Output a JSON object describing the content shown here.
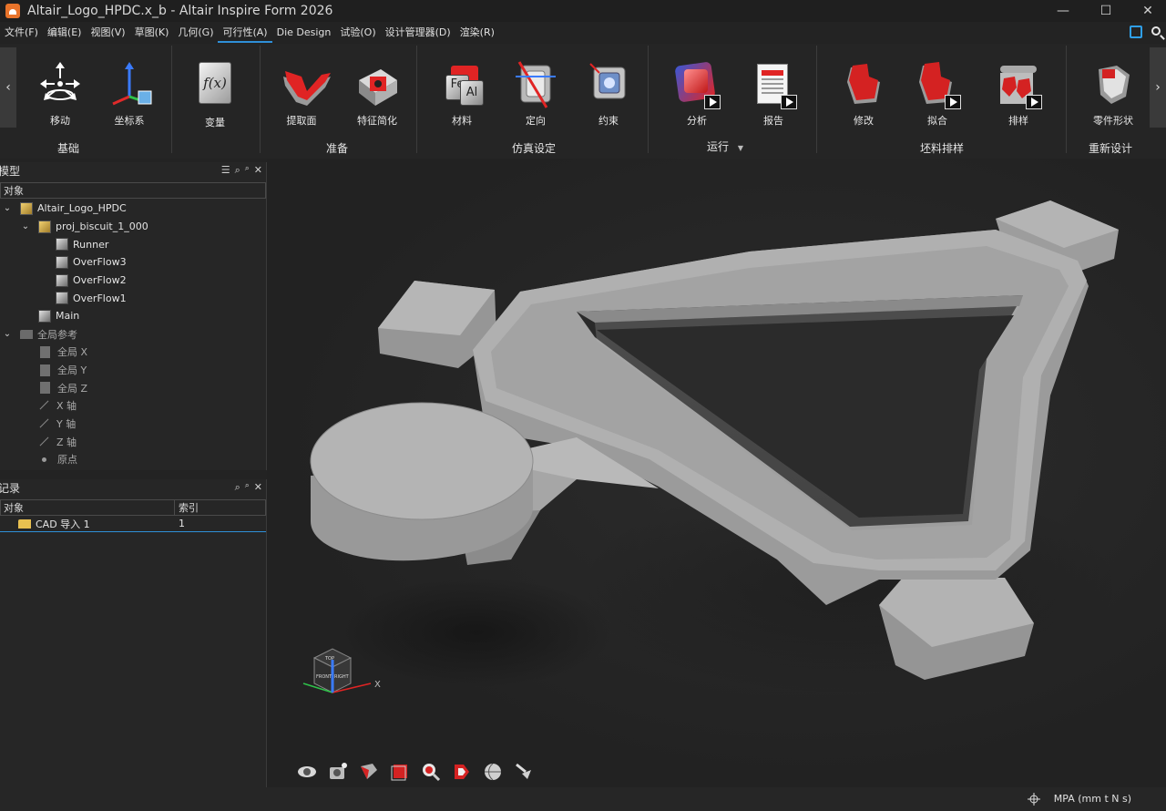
{
  "window": {
    "title": "Altair_Logo_HPDC.x_b - Altair Inspire Form 2026",
    "minimize": "—",
    "maximize": "☐",
    "close": "✕"
  },
  "menu": {
    "items": [
      "文件(F)",
      "编辑(E)",
      "视图(V)",
      "草图(K)",
      "几何(G)",
      "可行性(A)",
      "Die Design",
      "试验(O)",
      "设计管理器(D)",
      "渲染(R)"
    ],
    "active_index": 5
  },
  "ribbon": {
    "scroll_left": "‹",
    "scroll_right": "›",
    "tools": {
      "move": "移动",
      "coord": "坐标系",
      "variable": "变量",
      "extract": "提取面",
      "simplify": "特征简化",
      "material": "材料",
      "orient": "定向",
      "constraint": "约束",
      "analyze": "分析",
      "report": "报告",
      "modify": "修改",
      "fit": "拟合",
      "nest": "排样",
      "part_shape": "零件形状"
    },
    "groups": {
      "basic": "基础",
      "prepare": "准备",
      "sim_setup": "仿真设定",
      "run": "运行",
      "run_arrow": "▼",
      "blank_nest": "坯料排样",
      "redesign": "重新设计"
    },
    "variable_glyph": "f(x)",
    "material_glyph_fe": "Fe",
    "material_glyph_al": "Al"
  },
  "model_panel": {
    "title": "模型",
    "column": "对象",
    "tools": [
      "☰",
      "⌕",
      "🔍",
      "✕"
    ],
    "tree": [
      {
        "label": "Altair_Logo_HPDC",
        "level": 0,
        "expand": "⌄",
        "icon": "assembly"
      },
      {
        "label": "proj_biscuit_1_000",
        "level": 1,
        "expand": "⌄",
        "icon": "assembly"
      },
      {
        "label": "Runner",
        "level": 2,
        "expand": "",
        "icon": "part"
      },
      {
        "label": "OverFlow3",
        "level": 2,
        "expand": "",
        "icon": "part"
      },
      {
        "label": "OverFlow2",
        "level": 2,
        "expand": "",
        "icon": "part"
      },
      {
        "label": "OverFlow1",
        "level": 2,
        "expand": "",
        "icon": "part"
      },
      {
        "label": "Main",
        "level": 1,
        "expand": "",
        "icon": "part"
      },
      {
        "label": "全局参考",
        "level": 0,
        "expand": "⌄",
        "icon": "folder"
      },
      {
        "label": "全局 X",
        "level": 1,
        "expand": "",
        "icon": "plane"
      },
      {
        "label": "全局 Y",
        "level": 1,
        "expand": "",
        "icon": "plane"
      },
      {
        "label": "全局 Z",
        "level": 1,
        "expand": "",
        "icon": "plane"
      },
      {
        "label": "X 轴",
        "level": 1,
        "expand": "",
        "icon": "axis"
      },
      {
        "label": "Y 轴",
        "level": 1,
        "expand": "",
        "icon": "axis"
      },
      {
        "label": "Z 轴",
        "level": 1,
        "expand": "",
        "icon": "axis"
      },
      {
        "label": "原点",
        "level": 1,
        "expand": "",
        "icon": "point"
      }
    ]
  },
  "history_panel": {
    "title": "记录",
    "columns": [
      "对象",
      "索引"
    ],
    "rows": [
      {
        "object": "CAD 导入 1",
        "index": "1"
      }
    ]
  },
  "viewcube": {
    "faces": [
      "TOP",
      "FRONT",
      "RIGHT"
    ],
    "axes": {
      "x": "X",
      "y": "Y"
    }
  },
  "status": {
    "units": "MPA (mm t N s)"
  },
  "colors": {
    "accent": "#2f8fd8",
    "part_gray": "#a8a8a8",
    "background": "#232323"
  }
}
